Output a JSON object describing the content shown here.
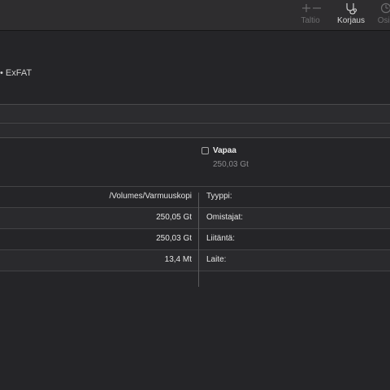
{
  "toolbar": {
    "items": [
      {
        "label": "Taltio",
        "icon": "plus-minus-icon",
        "state": "disabled"
      },
      {
        "label": "Korjaus",
        "icon": "stethoscope-icon",
        "state": "enabled"
      },
      {
        "label": "Osio",
        "icon": "clock-pie-icon",
        "state": "disabled"
      }
    ]
  },
  "volume": {
    "format_text": "• ExFAT"
  },
  "usage_legend": {
    "free": {
      "label": "Vapaa",
      "value": "250,03 Gt"
    }
  },
  "info": {
    "rows": [
      {
        "value": "/Volumes/Varmuuskopi",
        "key": "Tyyppi:"
      },
      {
        "value": "250,05 Gt",
        "key": "Omistajat:"
      },
      {
        "value": "250,03 Gt",
        "key": "Liitäntä:"
      },
      {
        "value": "13,4 Mt",
        "key": "Laite:"
      }
    ]
  },
  "colors": {
    "background": "#252528",
    "toolbar": "#2e2d2f",
    "text": "#e4e4e4",
    "secondary_text": "#8b8b8e"
  }
}
